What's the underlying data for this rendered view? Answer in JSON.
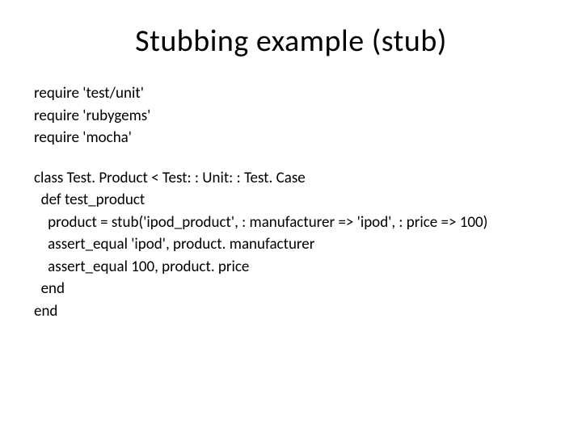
{
  "title": "Stubbing example (stub)",
  "requires": {
    "line1": "require 'test/unit'",
    "line2": "require 'rubygems'",
    "line3": "require 'mocha'"
  },
  "code": {
    "line1": "class Test. Product < Test: : Unit: : Test. Case",
    "line2": "  def test_product",
    "line3": "    product = stub('ipod_product', : manufacturer => 'ipod', : price => 100)",
    "line4": "    assert_equal 'ipod', product. manufacturer",
    "line5": "    assert_equal 100, product. price",
    "line6": "  end",
    "line7": "end"
  }
}
